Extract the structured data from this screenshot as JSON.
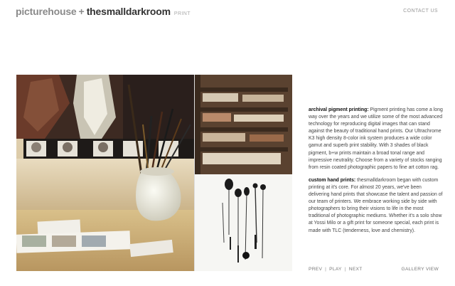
{
  "header": {
    "logo_part1": "picturehouse",
    "logo_plus": "+",
    "logo_part2": "thesmalldarkroom",
    "logo_part3": "PRINT",
    "contact_label": "CONTACT US"
  },
  "content": {
    "para1_title": "archival pigment printing:",
    "para1_text": " Pigment printing has come a long way over the years and we utilize some of the most advanced technology for reproducing digital images that can stand against the beauty of traditional hand prints. Our Ultrachrome K3 high density 8-color ink system produces a wide color gamut and superb print stability. With 3 shades of black pigment, b+w prints maintain a broad tonal range and impressive neutrality. Choose from a variety of stocks ranging from resin coated photographic papers to fine art cotton rag.",
    "para2_title": "custom hand prints:",
    "para2_text": " thesmalldarkroom began with custom printing at it's core. For almost 20 years, we've been delivering hand prints that showcase the talent and passion of our team of printers. We embrace working side by side with photographers to bring their visions to life in the most traditional of photographic mediums. Whether it's a solo show at Yossi Milo or a gift print for someone special, each print is made with TLC (tenderness, love and chemistry)."
  },
  "nav": {
    "prev": "PREV",
    "sep1": "|",
    "play": "PLAY",
    "sep2": "|",
    "next": "NEXT",
    "gallery_view": "GALLERY VIEW"
  },
  "icons": [
    "photo-collage"
  ]
}
